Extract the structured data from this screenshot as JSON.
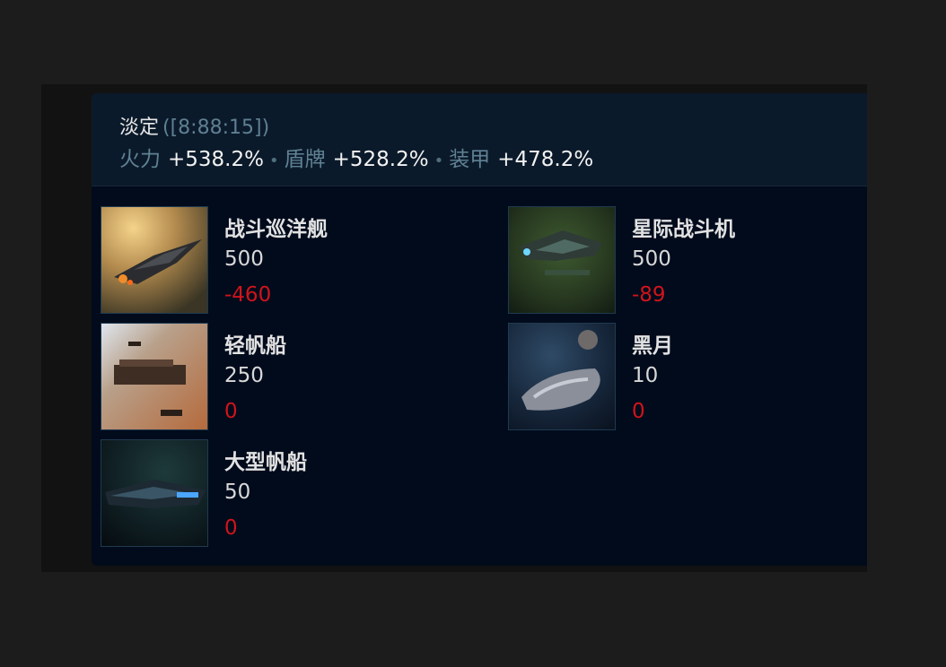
{
  "header": {
    "title": "淡定",
    "coords": "([8:88:15])",
    "stats": [
      {
        "label": "火力",
        "value": "+538.2%"
      },
      {
        "label": "盾牌",
        "value": "+528.2%"
      },
      {
        "label": "装甲",
        "value": "+478.2%"
      }
    ],
    "separator": "•"
  },
  "ships": [
    {
      "name": "战斗巡洋舰",
      "count": "500",
      "delta": "-460",
      "icon": "battlecruiser-image"
    },
    {
      "name": "星际战斗机",
      "count": "500",
      "delta": "-89",
      "icon": "starfighter-image"
    },
    {
      "name": "轻帆船",
      "count": "250",
      "delta": "0",
      "icon": "light-sailship-image"
    },
    {
      "name": "黑月",
      "count": "10",
      "delta": "0",
      "icon": "dark-moon-image"
    },
    {
      "name": "大型帆船",
      "count": "50",
      "delta": "0",
      "icon": "large-sailship-image"
    }
  ],
  "colors": {
    "delta": "#d0141b",
    "label": "#5f8294",
    "panel": "#010b1c",
    "header": "#0b1a2a"
  }
}
